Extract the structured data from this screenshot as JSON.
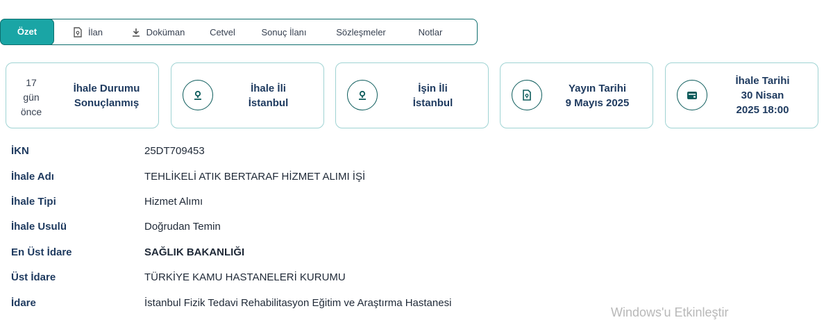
{
  "tabs": {
    "ozet": "Özet",
    "ilan": "İlan",
    "dokuman": "Doküman",
    "cetvel": "Cetvel",
    "sonuc_ilani": "Sonuç İlanı",
    "sozlesmeler": "Sözleşmeler",
    "notlar": "Notlar"
  },
  "cards": {
    "status": {
      "days_num": "17",
      "days_unit": "gün",
      "days_suffix": "önce",
      "title": "İhale Durumu",
      "value": "Sonuçlanmış"
    },
    "ihale_ili": {
      "title": "İhale İli",
      "value": "İstanbul",
      "icon": "location-pin-icon"
    },
    "isin_ili": {
      "title": "İşin İli",
      "value": "İstanbul",
      "icon": "location-pin-icon"
    },
    "yayin_tarihi": {
      "title": "Yayın Tarihi",
      "value": "9 Mayıs 2025",
      "icon": "document-icon"
    },
    "ihale_tarihi": {
      "title": "İhale Tarihi",
      "value_line1": "30 Nisan",
      "value_line2": "2025 18:00",
      "icon": "calendar-icon"
    }
  },
  "details": [
    {
      "label": "İKN",
      "value": "25DT709453"
    },
    {
      "label": "İhale Adı",
      "value": "TEHLİKELİ ATIK BERTARAF HİZMET ALIMI İŞİ"
    },
    {
      "label": "İhale Tipi",
      "value": "Hizmet Alımı"
    },
    {
      "label": "İhale Usulü",
      "value": "Doğrudan Temin"
    },
    {
      "label": "En Üst İdare",
      "value": "SAĞLIK BAKANLIĞI"
    },
    {
      "label": "Üst İdare",
      "value": "TÜRKİYE KAMU HASTANELERİ KURUMU"
    },
    {
      "label": "İdare",
      "value": "İstanbul Fizik Tedavi Rehabilitasyon Eğitim ve Araştırma Hastanesi"
    }
  ],
  "watermark": "Windows'u Etkinleştir",
  "colors": {
    "accent": "#1aa5a5",
    "border": "#9fd3d3",
    "heading": "#1e3a5f"
  }
}
